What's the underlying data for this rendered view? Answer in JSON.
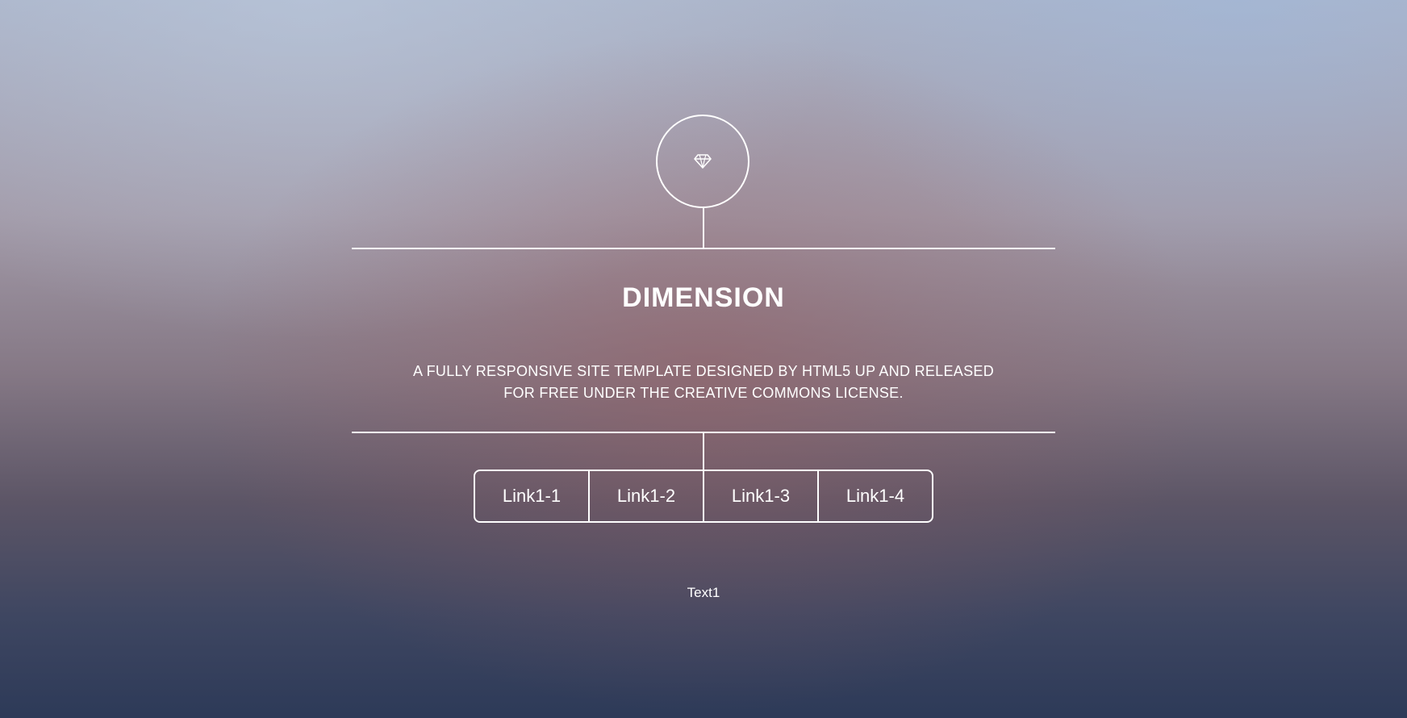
{
  "header": {
    "logo_icon": "diamond-icon",
    "title": "DIMENSION",
    "subtitle_line1": "A FULLY RESPONSIVE SITE TEMPLATE DESIGNED BY HTML5 UP AND RELEASED",
    "subtitle_line2": "FOR FREE UNDER THE CREATIVE COMMONS LICENSE."
  },
  "nav": {
    "items": [
      {
        "label": "Link1-1"
      },
      {
        "label": "Link1-2"
      },
      {
        "label": "Link1-3"
      },
      {
        "label": "Link1-4"
      }
    ]
  },
  "footer": {
    "text": "Text1"
  },
  "colors": {
    "foreground": "#ffffff",
    "background_top": "#aab3c8",
    "background_center": "#857885",
    "background_bottom": "#2d3a58"
  }
}
